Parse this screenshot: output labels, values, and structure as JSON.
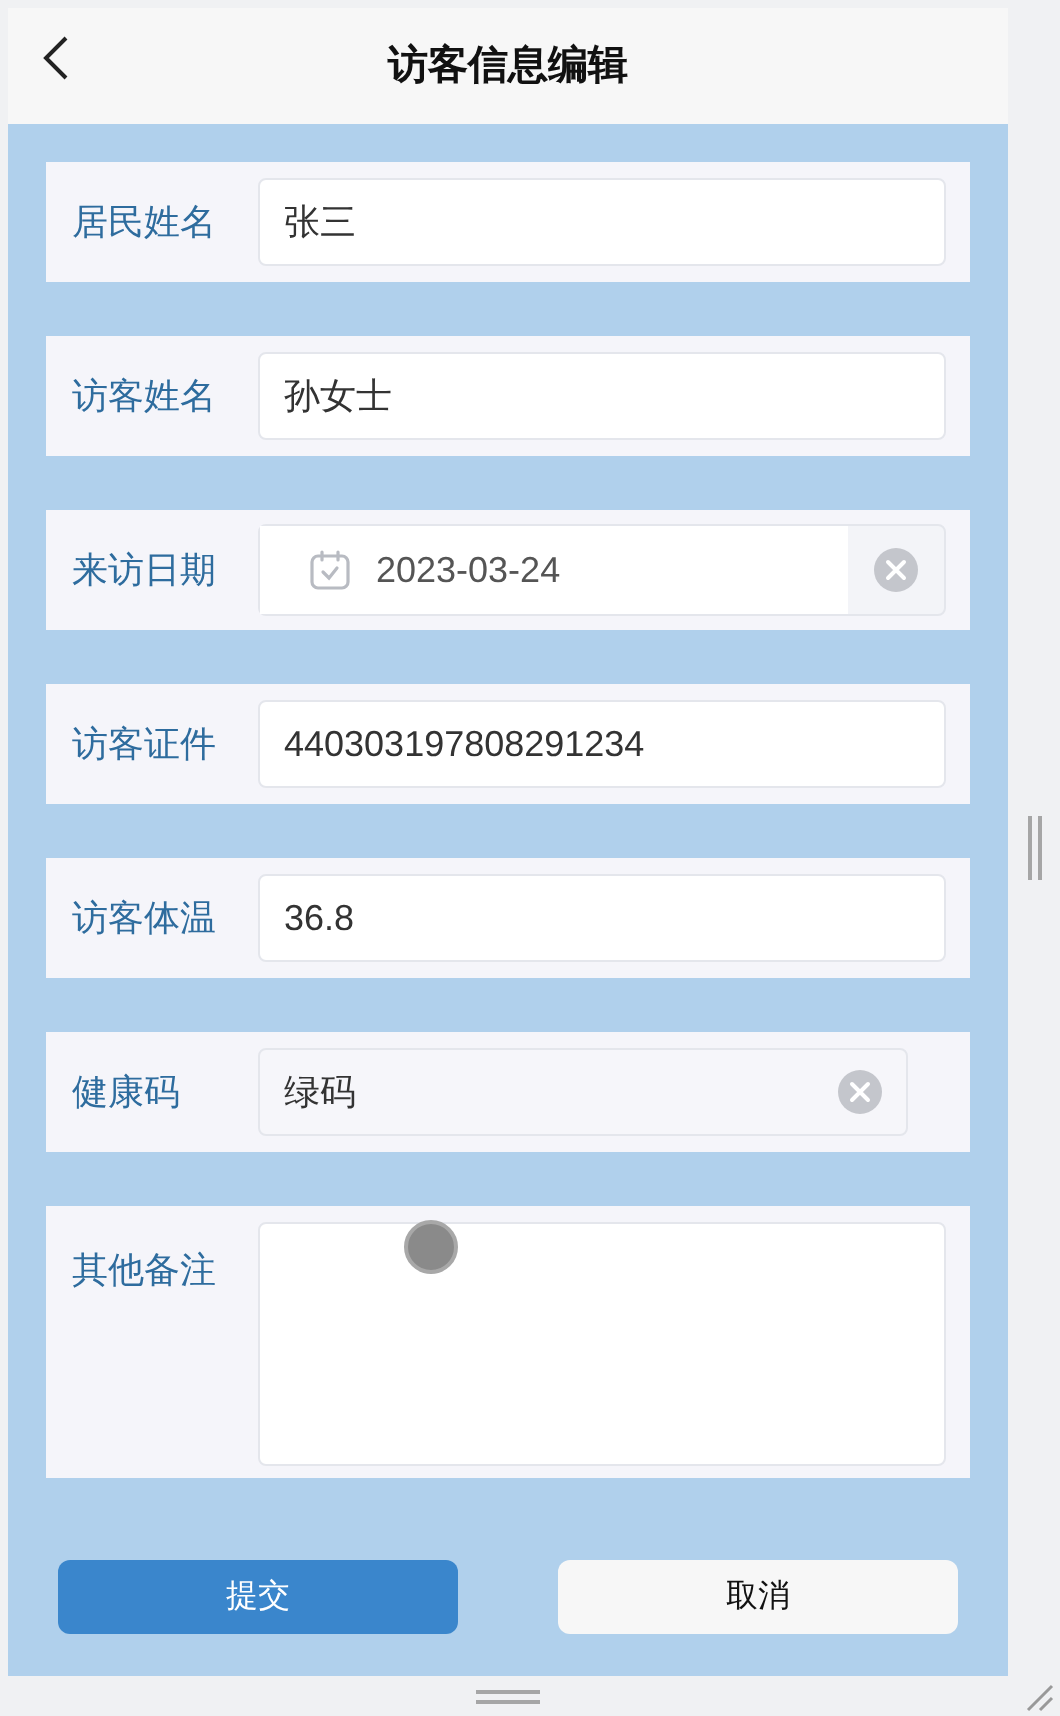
{
  "header": {
    "title": "访客信息编辑"
  },
  "fields": [
    {
      "kind": "text",
      "label": "居民姓名",
      "value": "张三"
    },
    {
      "kind": "text",
      "label": "访客姓名",
      "value": "孙女士"
    },
    {
      "kind": "date",
      "label": "来访日期",
      "value": "2023-03-24"
    },
    {
      "kind": "text",
      "label": "访客证件",
      "value": "440303197808291234"
    },
    {
      "kind": "text",
      "label": "访客体温",
      "value": "36.8"
    },
    {
      "kind": "select",
      "label": "健康码",
      "value": "绿码"
    },
    {
      "kind": "textarea",
      "label": "其他备注"
    }
  ],
  "buttons": [
    {
      "label": "提交",
      "kind": "primary"
    },
    {
      "label": "取消",
      "kind": "secondary"
    }
  ]
}
